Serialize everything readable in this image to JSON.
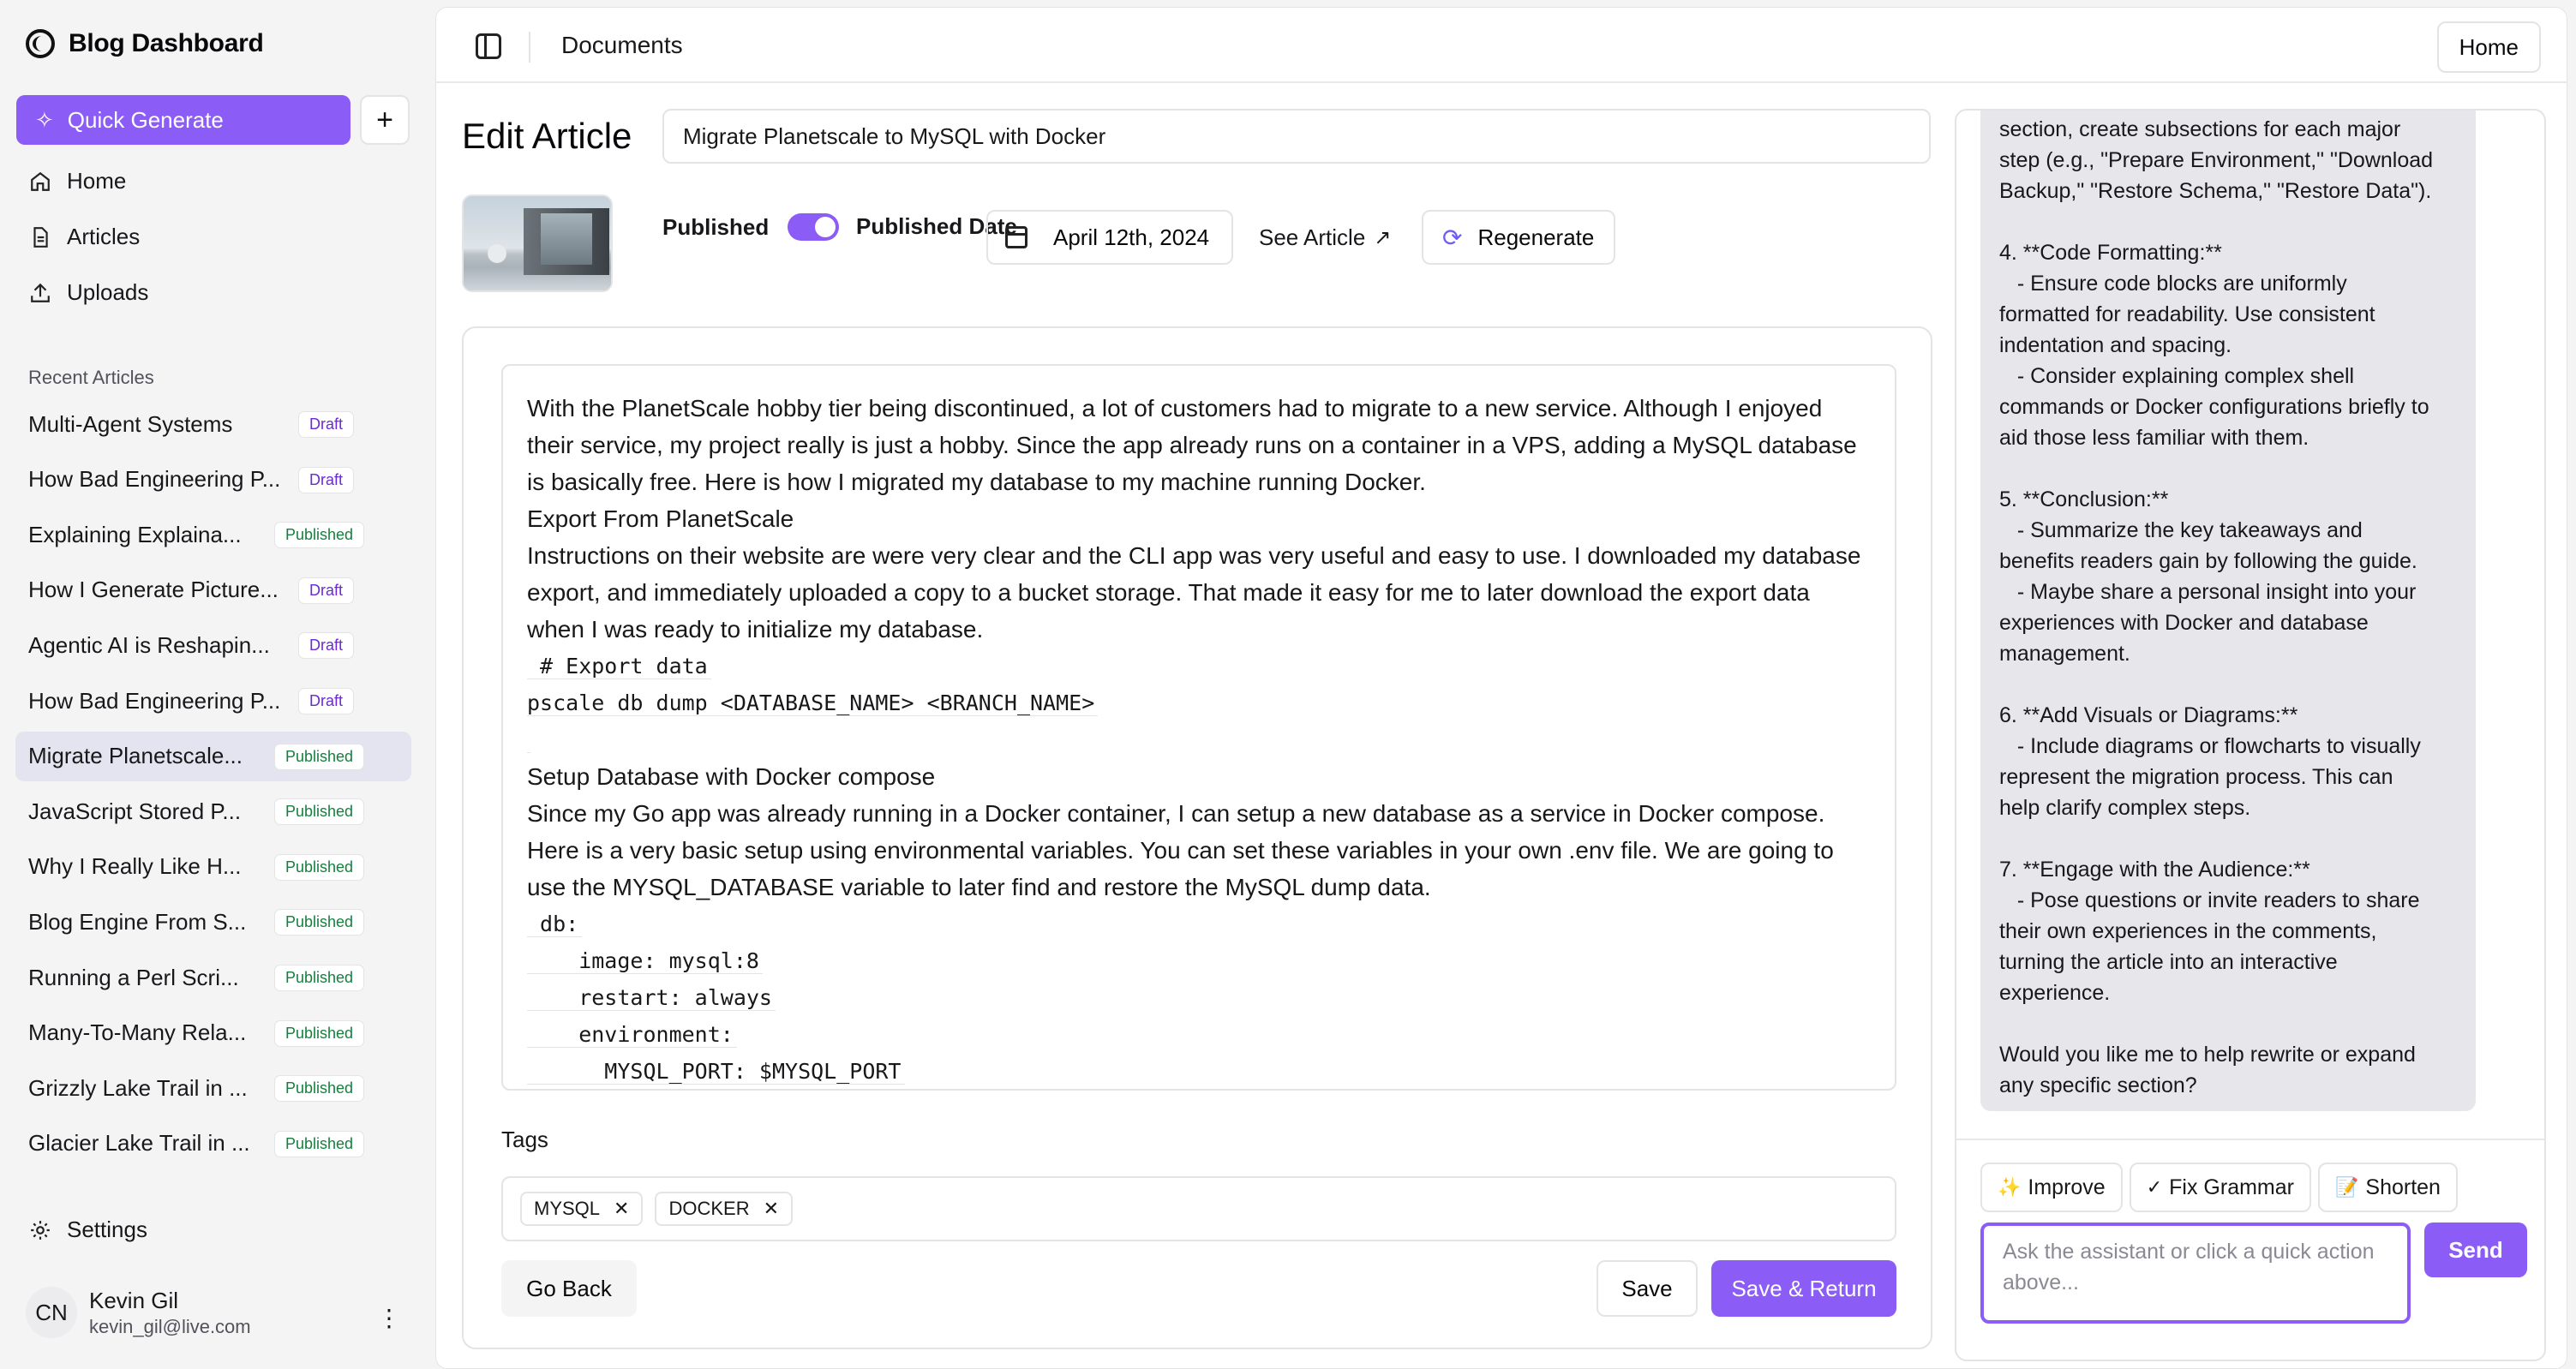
{
  "app": {
    "title": "Blog Dashboard"
  },
  "sidebar": {
    "quick_generate": "Quick Generate",
    "nav": [
      {
        "label": "Home",
        "icon": "home-icon"
      },
      {
        "label": "Articles",
        "icon": "file-icon"
      },
      {
        "label": "Uploads",
        "icon": "upload-icon"
      }
    ],
    "recent_title": "Recent Articles",
    "articles": [
      {
        "title": "Multi-Agent Systems",
        "status": "Draft"
      },
      {
        "title": "How Bad Engineering P...",
        "status": "Draft"
      },
      {
        "title": "Explaining Explaina...",
        "status": "Published"
      },
      {
        "title": "How I Generate Picture...",
        "status": "Draft"
      },
      {
        "title": "Agentic AI is Reshapin...",
        "status": "Draft"
      },
      {
        "title": "How Bad Engineering P...",
        "status": "Draft"
      },
      {
        "title": "Migrate Planetscale...",
        "status": "Published",
        "active": true
      },
      {
        "title": "JavaScript Stored P...",
        "status": "Published"
      },
      {
        "title": "Why I Really Like H...",
        "status": "Published"
      },
      {
        "title": "Blog Engine From S...",
        "status": "Published"
      },
      {
        "title": "Running a Perl Scri...",
        "status": "Published"
      },
      {
        "title": "Many-To-Many Rela...",
        "status": "Published"
      },
      {
        "title": "Grizzly Lake Trail in ...",
        "status": "Published"
      },
      {
        "title": "Glacier Lake Trail in ...",
        "status": "Published"
      }
    ],
    "settings": "Settings",
    "user": {
      "initials": "CN",
      "name": "Kevin Gil",
      "email": "kevin_gil@live.com"
    }
  },
  "header": {
    "title": "Documents",
    "home_button": "Home"
  },
  "editor": {
    "heading": "Edit Article",
    "title_value": "Migrate Planetscale to MySQL with Docker",
    "published_label": "Published",
    "published_on": true,
    "published_date_label": "Published Date",
    "date_value": "April 12th, 2024",
    "see_article": "See Article",
    "regenerate": "Regenerate",
    "content": {
      "p1": "With the PlanetScale hobby tier being discontinued, a lot of customers had to migrate to a new service. Although I enjoyed their service, my project really is just a hobby. Since the app already runs on a container in a VPS, adding a MySQL database is basically free. Here is how I migrated my database to my machine running Docker.",
      "h1": "Export From PlanetScale",
      "p2": "Instructions on their website are were very clear and the CLI app was very useful and easy to use. I downloaded my database export, and immediately uploaded a copy to a bucket storage. That made it easy for me to later download the export data when I was ready to initialize my database.",
      "code1": [
        " # Export data",
        "pscale db dump <DATABASE_NAME> <BRANCH_NAME>",
        ""
      ],
      "h2": "Setup Database with Docker compose",
      "p3": "Since my Go app was already running in a Docker container, I can setup a new database as a service in Docker compose. Here is a very basic setup using environmental variables. You can set these variables in your own .env file. We are going to use the MYSQL_DATABASE variable to later find and restore the MySQL dump data.",
      "code2": [
        " db:",
        "    image: mysql:8",
        "    restart: always",
        "    environment:",
        "      MYSQL_PORT: $MYSQL_PORT"
      ]
    },
    "tags_label": "Tags",
    "tags": [
      "MYSQL",
      "DOCKER"
    ],
    "go_back": "Go Back",
    "save": "Save",
    "save_return": "Save & Return"
  },
  "assistant": {
    "message": "section, create subsections for each major\nstep (e.g., \"Prepare Environment,\" \"Download\nBackup,\" \"Restore Schema,\" \"Restore Data\").\n\n4. **Code Formatting:**\n   - Ensure code blocks are uniformly\nformatted for readability. Use consistent\nindentation and spacing.\n   - Consider explaining complex shell\ncommands or Docker configurations briefly to\naid those less familiar with them.\n\n5. **Conclusion:**\n   - Summarize the key takeaways and\nbenefits readers gain by following the guide.\n   - Maybe share a personal insight into your\nexperiences with Docker and database\nmanagement.\n\n6. **Add Visuals or Diagrams:**\n   - Include diagrams or flowcharts to visually\nrepresent the migration process. This can\nhelp clarify complex steps.\n\n7. **Engage with the Audience:**\n   - Pose questions or invite readers to share\ntheir own experiences in the comments,\nturning the article into an interactive\nexperience.\n\nWould you like me to help rewrite or expand\nany specific section?",
    "quick_actions": [
      {
        "icon": "✨",
        "label": "Improve"
      },
      {
        "icon": "✓",
        "label": "Fix Grammar"
      },
      {
        "icon": "📝",
        "label": "Shorten"
      }
    ],
    "input_placeholder": "Ask the assistant or click a quick action above...",
    "send": "Send"
  }
}
